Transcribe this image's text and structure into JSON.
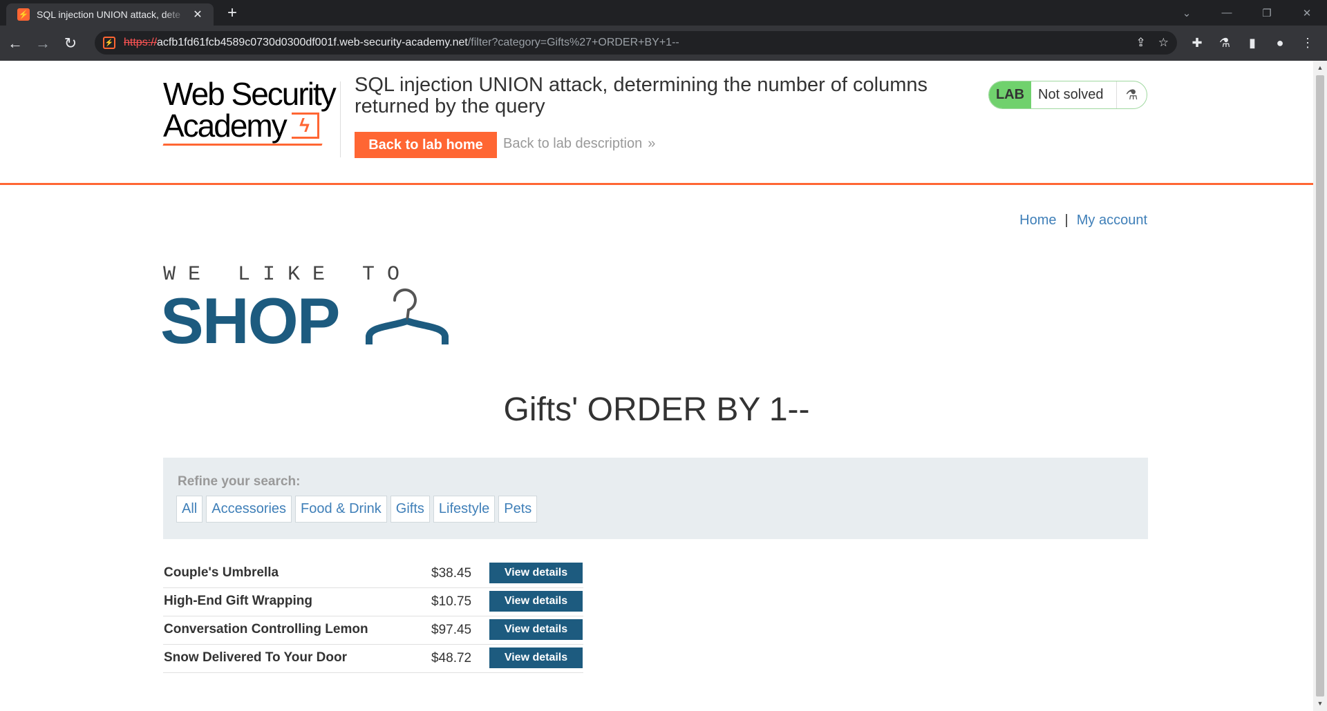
{
  "browser": {
    "tab_title": "SQL injection UNION attack, dete",
    "url_scheme": "https://",
    "url_host": "acfb1fd61fcb4589c0730d0300df001f.web-security-academy.net",
    "url_path": "/filter?category=Gifts%27+ORDER+BY+1--"
  },
  "header": {
    "logo_line1": "Web Security",
    "logo_line2": "Academy",
    "lab_title": "SQL injection UNION attack, determining the number of columns returned by the query",
    "back_home_label": "Back to lab home",
    "back_desc_label": "Back to lab description",
    "lab_badge": "LAB",
    "lab_status": "Not solved"
  },
  "nav": {
    "home": "Home",
    "separator": "|",
    "my_account": "My account"
  },
  "shop_logo": {
    "tagline": "WE LIKE TO",
    "word": "SHOP"
  },
  "category_heading": "Gifts' ORDER BY 1--",
  "filter": {
    "label": "Refine your search:",
    "tags": [
      "All",
      "Accessories",
      "Food & Drink",
      "Gifts",
      "Lifestyle",
      "Pets"
    ]
  },
  "products": [
    {
      "name": "Couple's Umbrella",
      "price": "$38.45",
      "button": "View details"
    },
    {
      "name": "High-End Gift Wrapping",
      "price": "$10.75",
      "button": "View details"
    },
    {
      "name": "Conversation Controlling Lemon",
      "price": "$97.45",
      "button": "View details"
    },
    {
      "name": "Snow Delivered To Your Door",
      "price": "$48.72",
      "button": "View details"
    }
  ],
  "colors": {
    "accent": "#ff6633",
    "brand_blue": "#1d5b7f",
    "link": "#3f7fb8",
    "lab_green": "#70d16d"
  }
}
